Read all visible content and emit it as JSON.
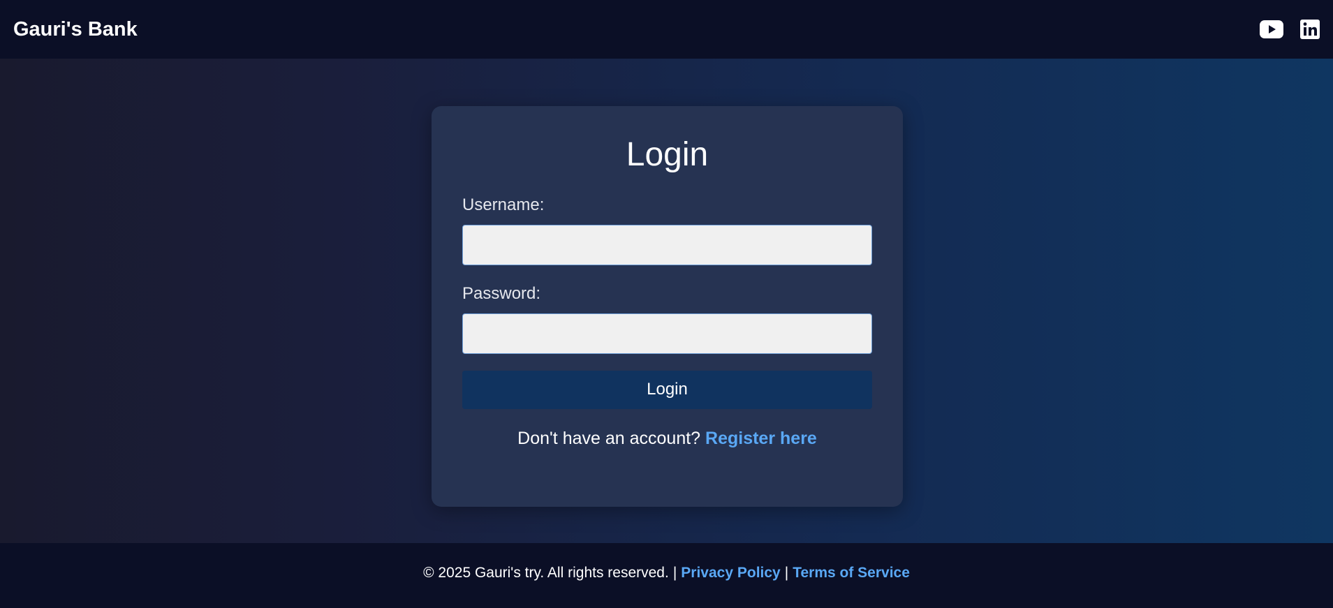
{
  "header": {
    "brand": "Gauri's Bank",
    "social": [
      {
        "icon": "youtube-icon"
      },
      {
        "icon": "linkedin-icon"
      }
    ]
  },
  "login": {
    "title": "Login",
    "username_label": "Username:",
    "username_value": "",
    "password_label": "Password:",
    "password_value": "",
    "submit_label": "Login",
    "register_prompt": "Don't have an account?",
    "register_link": "Register here"
  },
  "footer": {
    "copyright": "© 2025 Gauri's try. All rights reserved.",
    "separator": "|",
    "privacy": "Privacy Policy",
    "terms": "Terms of Service"
  },
  "colors": {
    "nav_background": "#0b0f26",
    "card_background": "#263352",
    "button_background": "#10335f",
    "link_color": "#5aa8f5",
    "input_background": "#f0f0f0"
  }
}
